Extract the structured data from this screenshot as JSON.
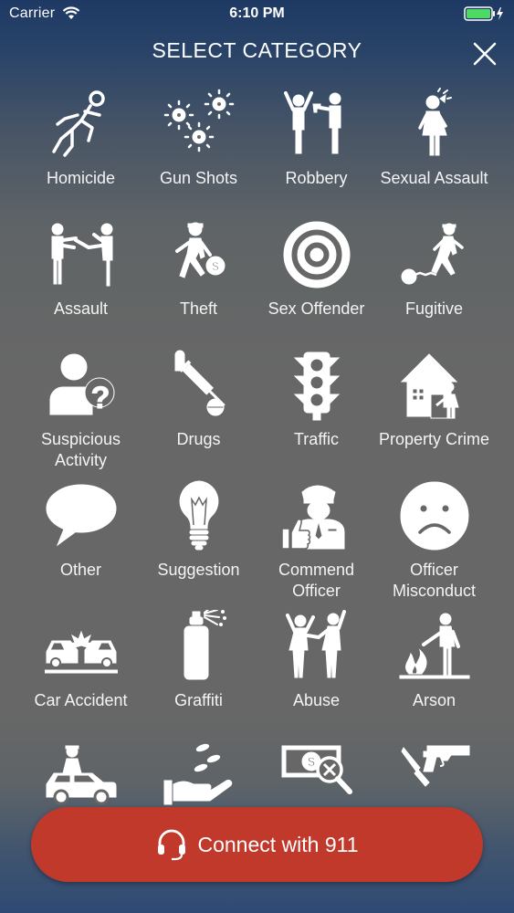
{
  "status_bar": {
    "carrier": "Carrier",
    "time": "6:10 PM"
  },
  "header": {
    "title": "SELECT CATEGORY"
  },
  "categories": [
    {
      "label": "Homicide",
      "icon": "homicide-icon"
    },
    {
      "label": "Gun Shots",
      "icon": "gun-shots-icon"
    },
    {
      "label": "Robbery",
      "icon": "robbery-icon"
    },
    {
      "label": "Sexual Assault",
      "icon": "sexual-assault-icon"
    },
    {
      "label": "Assault",
      "icon": "assault-icon"
    },
    {
      "label": "Theft",
      "icon": "theft-icon"
    },
    {
      "label": "Sex Offender",
      "icon": "target-icon"
    },
    {
      "label": "Fugitive",
      "icon": "fugitive-icon"
    },
    {
      "label": "Suspicious\nActivity",
      "icon": "suspicious-person-icon"
    },
    {
      "label": "Drugs",
      "icon": "drugs-icon"
    },
    {
      "label": "Traffic",
      "icon": "traffic-light-icon"
    },
    {
      "label": "Property Crime",
      "icon": "property-crime-icon"
    },
    {
      "label": "Other",
      "icon": "speech-bubble-icon"
    },
    {
      "label": "Suggestion",
      "icon": "light-bulb-icon"
    },
    {
      "label": "Commend\nOfficer",
      "icon": "commend-officer-icon"
    },
    {
      "label": "Officer\nMisconduct",
      "icon": "sad-face-icon"
    },
    {
      "label": "Car Accident",
      "icon": "car-accident-icon"
    },
    {
      "label": "Graffiti",
      "icon": "spray-can-icon"
    },
    {
      "label": "Abuse",
      "icon": "abuse-icon"
    },
    {
      "label": "Arson",
      "icon": "arson-icon"
    },
    {
      "label": "",
      "icon": "police-car-icon"
    },
    {
      "label": "",
      "icon": "bribery-hand-icon"
    },
    {
      "label": "",
      "icon": "money-fraud-icon"
    },
    {
      "label": "",
      "icon": "weapons-icon"
    }
  ],
  "connect_button": {
    "label": "Connect with 911",
    "icon": "headset-icon",
    "color": "#c0392b"
  },
  "colors": {
    "background": "#676767",
    "header_gradient": "#1e3a64",
    "battery": "#4cd964"
  }
}
